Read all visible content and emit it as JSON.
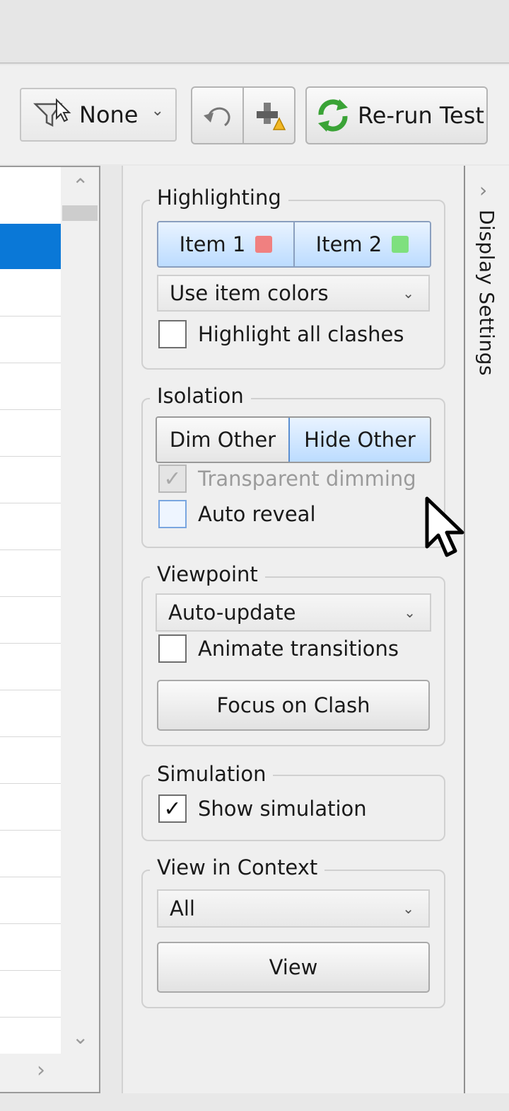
{
  "toolbar": {
    "filter_value": "None",
    "rerun_label": "Re-run Test"
  },
  "icons": {
    "filter": "funnel-icon",
    "undo": "undo-icon",
    "assign": "assign-icon",
    "rerun": "refresh-icon"
  },
  "display_settings": {
    "tab_title": "Display Settings",
    "highlighting": {
      "legend": "Highlighting",
      "item1": "Item 1",
      "item1_color": "#f08080",
      "item2": "Item 2",
      "item2_color": "#7ee07e",
      "mode": "Use item colors",
      "highlight_all": "Highlight all clashes",
      "highlight_all_checked": false
    },
    "isolation": {
      "legend": "Isolation",
      "dim_other": "Dim Other",
      "hide_other": "Hide Other",
      "transparent_dimming": "Transparent dimming",
      "transparent_dimming_checked": true,
      "auto_reveal": "Auto reveal",
      "auto_reveal_checked": false
    },
    "viewpoint": {
      "legend": "Viewpoint",
      "mode": "Auto-update",
      "animate": "Animate transitions",
      "animate_checked": false,
      "focus_button": "Focus on Clash"
    },
    "simulation": {
      "legend": "Simulation",
      "show": "Show simulation",
      "show_checked": true
    },
    "view_in_context": {
      "legend": "View in Context",
      "mode": "All",
      "view_button": "View"
    }
  },
  "colors": {
    "selection": "#0a78d7"
  }
}
